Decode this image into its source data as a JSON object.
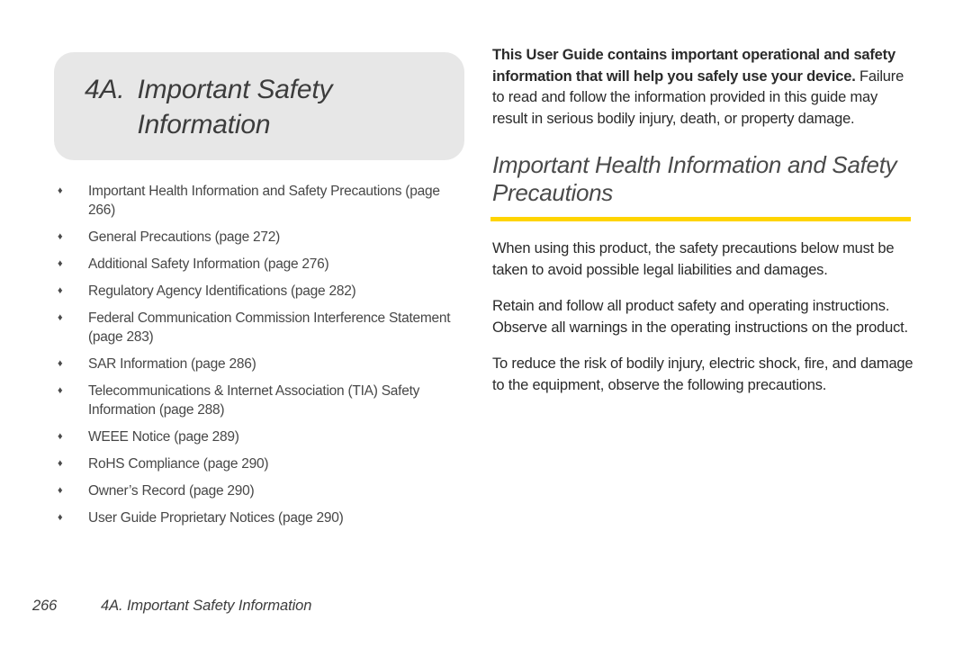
{
  "chapter": {
    "number": "4A.",
    "name": "Important Safety Information",
    "bullet_glyph": "♦"
  },
  "toc": {
    "items": [
      {
        "label": "Important Health Information and Safety Precautions (page 266)"
      },
      {
        "label": "General Precautions (page 272)"
      },
      {
        "label": "Additional Safety Information (page 276)"
      },
      {
        "label": "Regulatory Agency Identifications (page 282)"
      },
      {
        "label": "Federal Communication Commission Interference Statement (page 283)"
      },
      {
        "label": "SAR Information (page 286)"
      },
      {
        "label": "Telecommunications & Internet Association (TIA) Safety Information (page 288)"
      },
      {
        "label": "WEEE Notice (page 289)"
      },
      {
        "label": "RoHS Compliance (page 290)"
      },
      {
        "label": "Owner’s Record (page 290)"
      },
      {
        "label": "User Guide Proprietary Notices (page 290)"
      }
    ]
  },
  "intro": {
    "bold_lead": "This User Guide contains important operational and safety information that will help you safely use your device.",
    "rest": " Failure to read and follow the information provided in this guide may result in serious bodily injury, death, or property damage."
  },
  "section": {
    "heading": "Important Health Information and Safety Precautions",
    "rule_color": "#ffd400",
    "paragraphs": [
      "When using this product, the safety precautions below must be taken to avoid possible legal liabilities and damages.",
      "Retain and follow all product safety and operating instructions. Observe all warnings in the operating instructions on the product.",
      "To reduce the risk of bodily injury, electric shock, fire, and damage to the equipment, observe the following precautions."
    ]
  },
  "footer": {
    "page_number": "266",
    "running_title": "4A. Important Safety Information"
  }
}
